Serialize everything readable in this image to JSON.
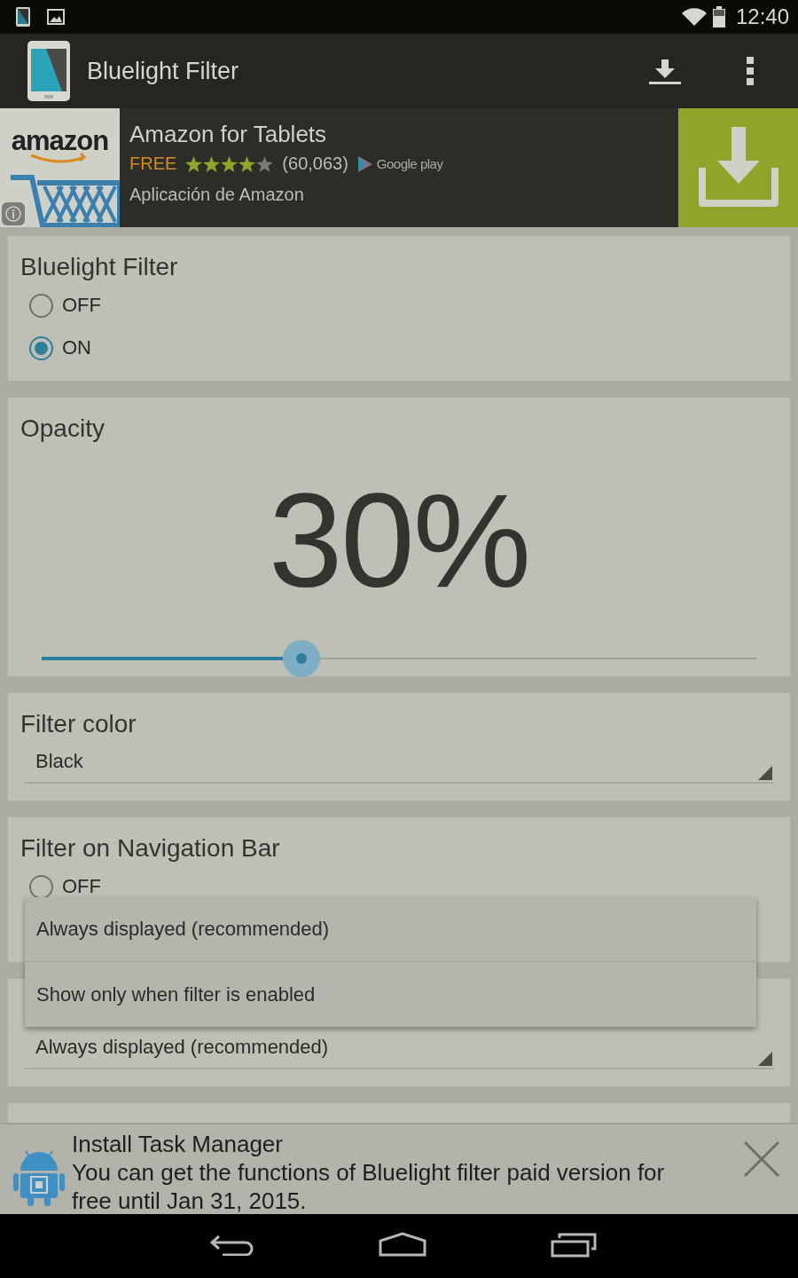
{
  "status_bar": {
    "time": "12:40"
  },
  "app_bar": {
    "title": "Bluelight Filter"
  },
  "ad": {
    "logo_text": "amazon",
    "title": "Amazon for Tablets",
    "price": "FREE",
    "stars": 4,
    "rating_count": "(60,063)",
    "store": "Google play",
    "publisher": "Aplicación de Amazon"
  },
  "sections": [
    {
      "kind": "radio",
      "title": "Bluelight Filter",
      "options": [
        {
          "label": "OFF",
          "selected": false
        },
        {
          "label": "ON",
          "selected": true
        }
      ]
    },
    {
      "kind": "slider",
      "title": "Opacity",
      "value": "30%",
      "level": 0.37
    },
    {
      "kind": "dropdown",
      "title": "Filter color",
      "value": "Black"
    },
    {
      "kind": "radio",
      "title": "Filter on Navigation Bar",
      "options": [
        {
          "label": "OFF",
          "selected": false
        }
      ]
    },
    {
      "kind": "dropdown",
      "value": "Always displayed (recommended)"
    }
  ],
  "popup": {
    "options": [
      "Always displayed (recommended)",
      "Show only when filter is enabled"
    ]
  },
  "notification": {
    "title": "Install Task Manager",
    "message": "You can get the functions of Bluelight filter paid version for free until Jan 31, 2015."
  }
}
